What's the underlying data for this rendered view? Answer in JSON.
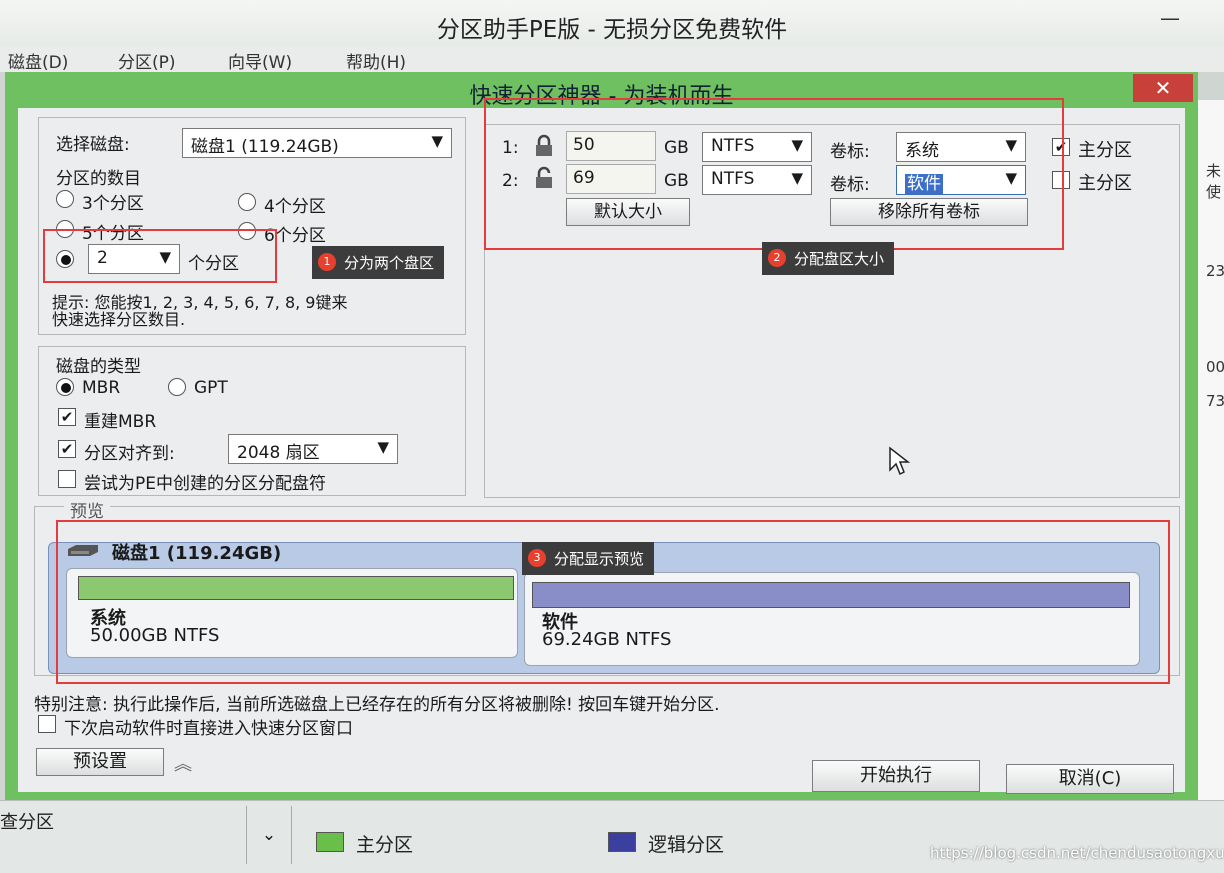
{
  "app": {
    "title": "分区助手PE版 - 无损分区免费软件",
    "minimize": "—",
    "menu": [
      "磁盘(D)",
      "分区(P)",
      "向导(W)",
      "帮助(H)"
    ],
    "status_left": "查分区",
    "dropdown": "⌄",
    "edge_fragments": [
      "未使",
      "23",
      "00",
      "73"
    ]
  },
  "dialog": {
    "title": "快速分区神器 - 为装机而生",
    "close": "✕",
    "select_disk_label": "选择磁盘:",
    "selected_disk": "磁盘1 (119.24GB)",
    "partition_count_label": "分区的数目",
    "count_options": [
      "3个分区",
      "4个分区",
      "5个分区",
      "6个分区"
    ],
    "custom_count": "2",
    "custom_count_suffix": "个分区",
    "hint_line1": "提示: 您能按1, 2, 3, 4, 5, 6, 7, 8, 9键来",
    "hint_line2": "快速选择分区数目.",
    "disk_type_label": "磁盘的类型",
    "mbr": "MBR",
    "gpt": "GPT",
    "rebuild_mbr": "重建MBR",
    "align_label": "分区对齐到:",
    "align_value": "2048 扇区",
    "assign_letter": "尝试为PE中创建的分区分配盘符",
    "partitions": [
      {
        "index": "1:",
        "size": "50",
        "unit": "GB",
        "fs": "NTFS",
        "label_caption": "卷标:",
        "label": "系统",
        "primary": "主分区",
        "primary_checked": true
      },
      {
        "index": "2:",
        "size": "69",
        "unit": "GB",
        "fs": "NTFS",
        "label_caption": "卷标:",
        "label": "软件",
        "primary": "主分区",
        "primary_checked": false
      }
    ],
    "default_size_btn": "默认大小",
    "remove_labels_btn": "移除所有卷标",
    "preview_label": "预览",
    "preview_disk": "磁盘1 (119.24GB)",
    "preview_parts": [
      {
        "name": "系统",
        "info": "50.00GB NTFS",
        "color": "#8cc870"
      },
      {
        "name": "软件",
        "info": "69.24GB NTFS",
        "color": "#8a8ec8"
      }
    ],
    "warning": "特别注意: 执行此操作后, 当前所选磁盘上已经存在的所有分区将被删除! 按回车键开始分区.",
    "open_next_time": "下次启动软件时直接进入快速分区窗口",
    "preset_btn": "预设置",
    "expand_icon": "︽",
    "start_btn": "开始执行",
    "cancel_btn": "取消(C)"
  },
  "annotations": [
    {
      "num": "1",
      "text": "分为两个盘区"
    },
    {
      "num": "2",
      "text": "分配盘区大小"
    },
    {
      "num": "3",
      "text": "分配显示预览"
    }
  ],
  "legend": [
    {
      "label": "主分区",
      "color": "#6abf4b"
    },
    {
      "label": "逻辑分区",
      "color": "#3b3fa0"
    }
  ],
  "watermark": "https://blog.csdn.net/chendusaotongxue"
}
